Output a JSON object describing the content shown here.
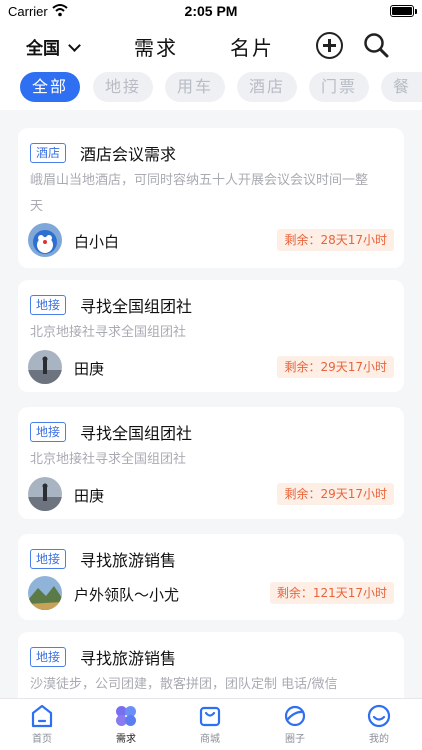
{
  "status_bar": {
    "carrier": "Carrier",
    "time": "2:05 PM"
  },
  "nav": {
    "region": "全国",
    "tabs": [
      "需求",
      "名片"
    ]
  },
  "filters": [
    "全部",
    "地接",
    "用车",
    "酒店",
    "门票",
    "餐"
  ],
  "cards": [
    {
      "tag": "酒店",
      "title": "酒店会议需求",
      "desc_line1": "峨眉山当地酒店，可同时容纳五十人开展会议会议时间一整",
      "desc_line2": "天",
      "user": "白小白",
      "remaining": "剩余：28天17小时"
    },
    {
      "tag": "地接",
      "title": "寻找全国组团社",
      "desc": "北京地接社寻求全国组团社",
      "user": "田庚",
      "remaining": "剩余：29天17小时"
    },
    {
      "tag": "地接",
      "title": "寻找全国组团社",
      "desc": "北京地接社寻求全国组团社",
      "user": "田庚",
      "remaining": "剩余：29天17小时"
    },
    {
      "tag": "地接",
      "title": "寻找旅游销售",
      "user": "户外领队～小尤",
      "remaining": "剩余：121天17小时"
    },
    {
      "tag": "地接",
      "title": "寻找旅游销售",
      "desc": "沙漠徒步，公司团建，散客拼团，团队定制 电话/微信"
    }
  ],
  "tabbar": [
    "首页",
    "需求",
    "商城",
    "圈子",
    "我的"
  ],
  "colors": {
    "accent": "#2f6ff2",
    "remain_text": "#e8643a",
    "remain_bg": "#fdeee6"
  }
}
